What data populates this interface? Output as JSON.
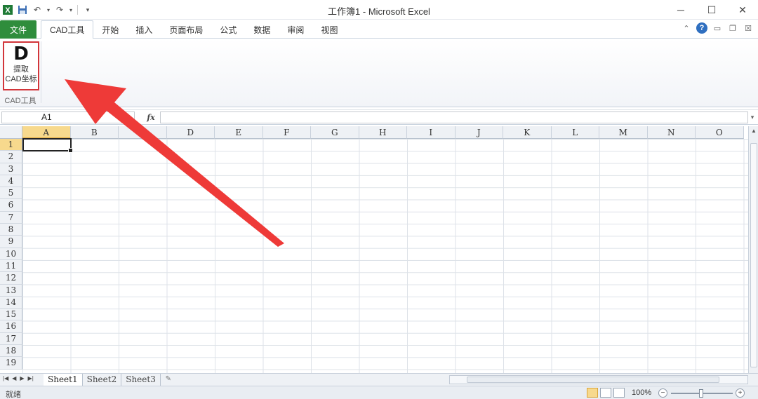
{
  "title": "工作簿1 - Microsoft Excel",
  "qat": {
    "save_icon": "save-icon",
    "undo_icon": "undo-icon",
    "redo_icon": "redo-icon"
  },
  "window_controls": {
    "minimize": "─",
    "maximize": "☐",
    "close": "✕"
  },
  "ribbon": {
    "file_tab": "文件",
    "tabs": [
      {
        "label": "CAD工具",
        "active": true
      },
      {
        "label": "开始",
        "active": false
      },
      {
        "label": "插入",
        "active": false
      },
      {
        "label": "页面布局",
        "active": false
      },
      {
        "label": "公式",
        "active": false
      },
      {
        "label": "数据",
        "active": false
      },
      {
        "label": "审阅",
        "active": false
      },
      {
        "label": "视图",
        "active": false
      }
    ],
    "help": "?",
    "cad_button": {
      "icon_text": "D",
      "label_line1": "提取",
      "label_line2": "CAD坐标"
    },
    "group_label": "CAD工具"
  },
  "formula_bar": {
    "name_box": "A1",
    "fx": "fx",
    "formula": ""
  },
  "grid": {
    "columns": [
      "A",
      "B",
      "C",
      "D",
      "E",
      "F",
      "G",
      "H",
      "I",
      "J",
      "K",
      "L",
      "M",
      "N",
      "O"
    ],
    "rows": [
      "1",
      "2",
      "3",
      "4",
      "5",
      "6",
      "7",
      "8",
      "9",
      "10",
      "11",
      "12",
      "13",
      "14",
      "15",
      "16",
      "17",
      "18",
      "19"
    ],
    "selected_cell": "A1"
  },
  "sheets": {
    "tabs": [
      {
        "label": "Sheet1",
        "active": true
      },
      {
        "label": "Sheet2",
        "active": false
      },
      {
        "label": "Sheet3",
        "active": false
      }
    ]
  },
  "status": {
    "ready": "就绪",
    "zoom": "100%"
  },
  "colors": {
    "file_tab": "#2f8d3c",
    "highlight_border": "#d2353a",
    "annotation_arrow": "#ee3a38",
    "selected_header": "#f7d98d"
  }
}
